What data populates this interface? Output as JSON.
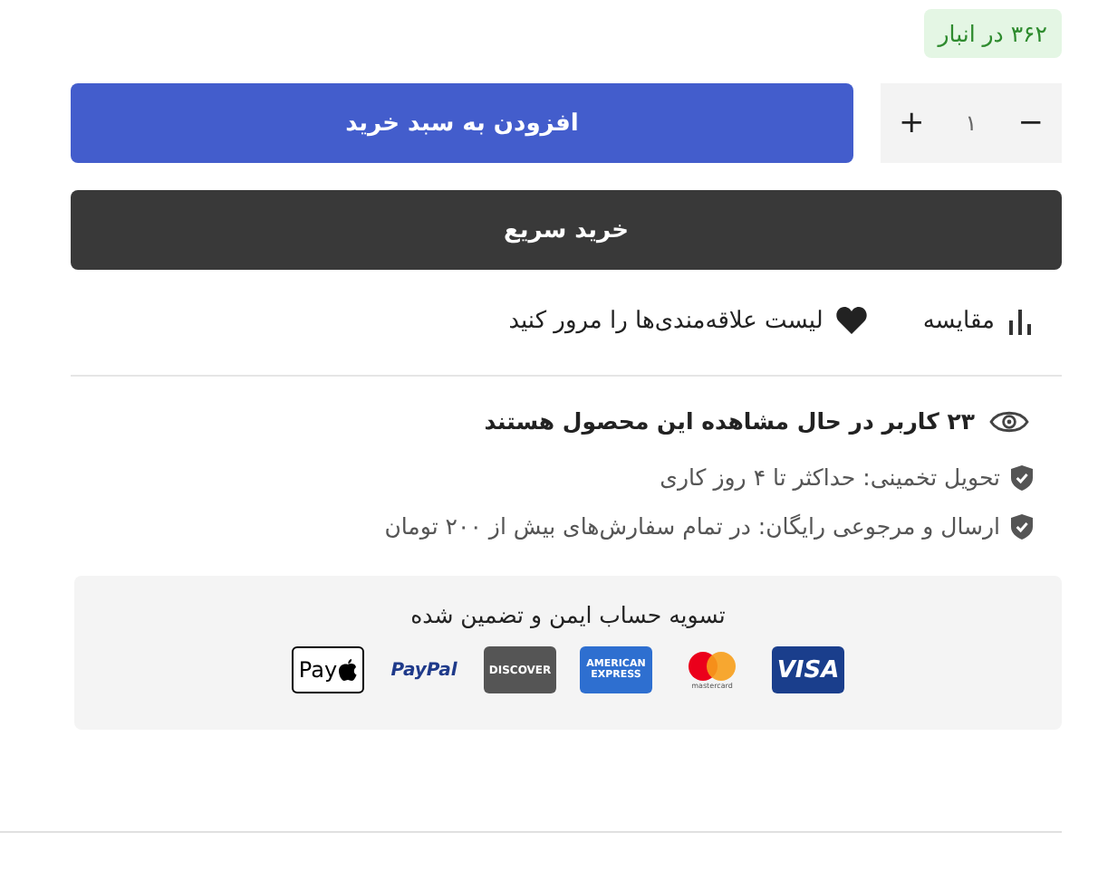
{
  "stock_badge": "۳۶۲ در انبار",
  "quantity": {
    "minus": "−",
    "value": "۱",
    "plus": "+"
  },
  "add_to_cart": "افزودن به سبد خرید",
  "quick_buy": "خرید سریع",
  "links": [
    {
      "kind": "compare",
      "label": "مقایسه"
    },
    {
      "kind": "wishlist",
      "label": "لیست علاقه‌مندی‌ها را مرور کنید"
    }
  ],
  "viewers": {
    "count": "۲۳",
    "text": "کاربر در حال مشاهده این محصول هستند"
  },
  "features": [
    "تحویل تخمینی: حداکثر تا ۴ روز کاری",
    "ارسال و مرجوعی رایگان: در تمام سفارش‌های بیش از ۲۰۰ تومان"
  ],
  "payment": {
    "title": "تسویه حساب ایمن و تضمین شده",
    "cards": [
      {
        "kind": "visa",
        "label": "VISA"
      },
      {
        "kind": "mastercard",
        "label": "mastercard"
      },
      {
        "kind": "amex",
        "label": "AMERICAN EXPRESS"
      },
      {
        "kind": "discover",
        "label": "DISCOVER"
      },
      {
        "kind": "paypal",
        "label": "PayPal"
      },
      {
        "kind": "applepay",
        "label": "Pay"
      }
    ]
  }
}
